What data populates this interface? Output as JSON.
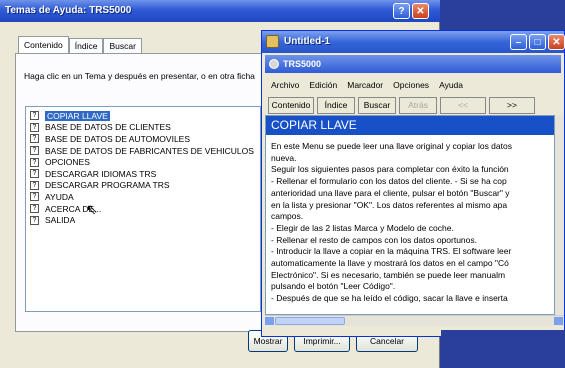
{
  "help_window": {
    "title": "Temas de Ayuda: TRS5000",
    "tabs": [
      "Contenido",
      "Índice",
      "Buscar"
    ],
    "hint": "Haga clic en un Tema y después en presentar, o en otra ficha",
    "topics": [
      "COPIAR LLAVE",
      "BASE DE DATOS DE CLIENTES",
      "BASE DE DATOS DE AUTOMOVILES",
      "BASE DE DATOS DE FABRICANTES DE VEHICULOS",
      "OPCIONES",
      "DESCARGAR IDIOMAS TRS",
      "DESCARGAR PROGRAMA TRS",
      "AYUDA",
      "ACERCA DE...",
      "SALIDA"
    ],
    "selected_topic": 0,
    "buttons": {
      "show": "Mostrar",
      "print": "Imprimir...",
      "cancel": "Cancelar"
    }
  },
  "untitled_window": {
    "title": "Untitled-1",
    "app_title": "TRS5000",
    "menu": [
      "Archivo",
      "Edición",
      "Marcador",
      "Opciones",
      "Ayuda"
    ],
    "toolbar": {
      "contents": "Contenido",
      "index": "Índice",
      "search": "Buscar",
      "back": "Atrás",
      "prev": "<<",
      "next": ">>"
    },
    "content_title": "COPIAR LLAVE",
    "content_lines": [
      "En este Menu se puede leer una llave original y copiar los datos",
      "nueva.",
      "Seguir los siguientes pasos para completar con éxito la función",
      "- Rellenar el formulario con los datos del cliente. - Si se ha cop",
      "anterioridad una llave para el cliente, pulsar el botón \"Buscar\" y",
      "en la lista y presionar \"OK\". Los datos referentes al mismo apa",
      "campos.",
      "- Elegir de las 2 listas Marca y Modelo de coche.",
      "- Rellenar el resto de campos con los datos oportunos.",
      "- Introducir la llave a copiar en la máquina TRS. El software leer",
      "automaticamente la llave y mostrará los datos en el campo \"Có",
      "Electrónico\". Si es necesario, también se puede leer manualm",
      "pulsando el botón \"Leer Código\".",
      "- Después de que se ha leído el código, sacar la llave e inserta"
    ]
  },
  "colors": {
    "titlebar": "#2f5bd6",
    "selection": "#316ac5",
    "content_header": "#1850c8",
    "desktop": "#2a3f9a"
  }
}
